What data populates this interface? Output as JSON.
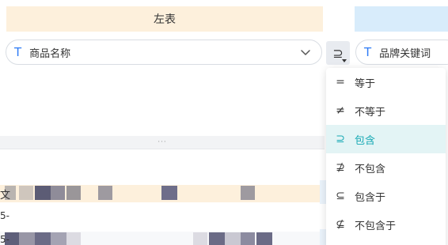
{
  "left_table": {
    "title": "左表"
  },
  "left_field": {
    "type_icon": "T",
    "label": "商品名称",
    "chevron": "chevron-down-icon"
  },
  "right_field": {
    "type_icon": "T",
    "label": "品牌关键词"
  },
  "operator_button": {
    "symbol": "⊇",
    "icon": "contains-icon"
  },
  "preview": {
    "drag_handle": "···",
    "header_fragment": "文",
    "rows": [
      "5-",
      "5-"
    ]
  },
  "operators": [
    {
      "symbol": "=",
      "label": "等于",
      "selected": false
    },
    {
      "symbol": "≠",
      "label": "不等于",
      "selected": false
    },
    {
      "symbol": "⊇",
      "label": "包含",
      "selected": true
    },
    {
      "symbol": "⊉",
      "label": "不包含",
      "selected": false
    },
    {
      "symbol": "⊆",
      "label": "包含于",
      "selected": false
    },
    {
      "symbol": "⊈",
      "label": "不包含于",
      "selected": false
    }
  ],
  "colors": {
    "accent": "#16a9b4",
    "selected_bg": "#e3f4f5",
    "left_header_bg": "#fdf0dc",
    "right_header_bg": "#d8ecfb",
    "type_icon": "#2f7cf6"
  }
}
